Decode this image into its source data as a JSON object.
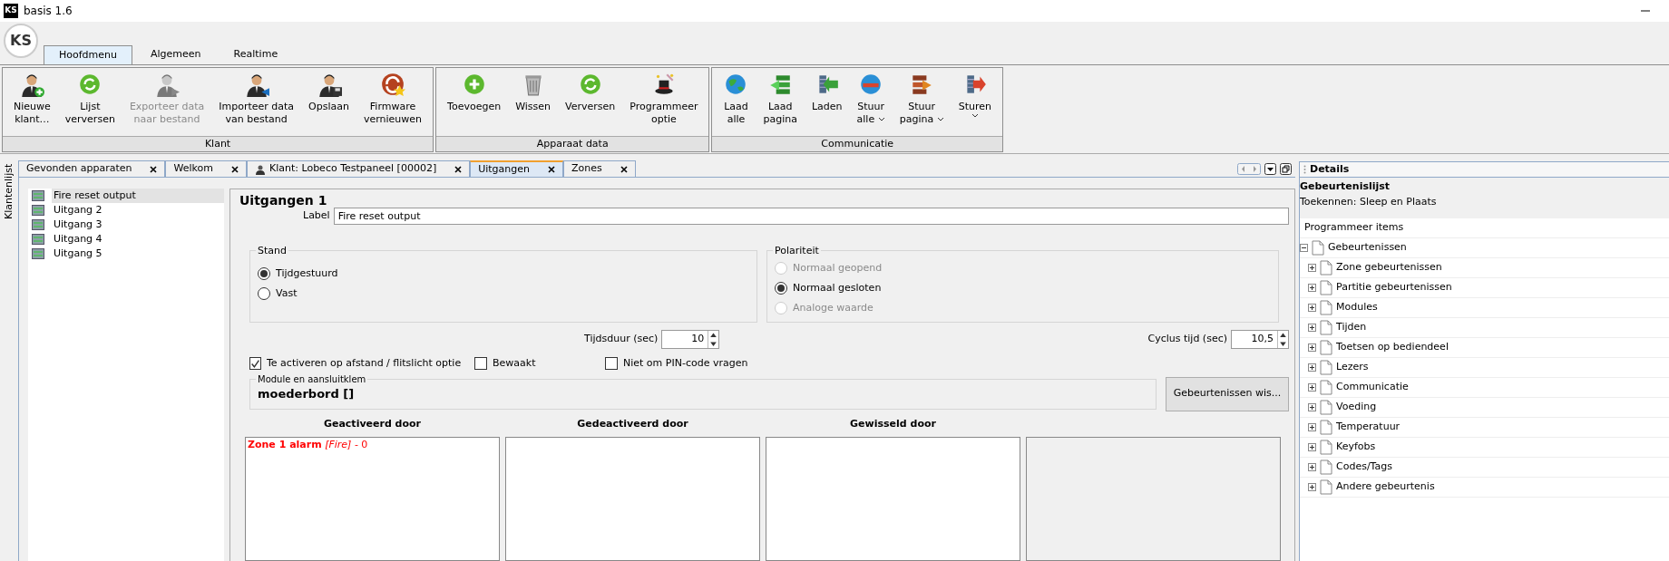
{
  "window": {
    "title": "basis 1.6",
    "logo": "KS"
  },
  "ribbon_logo": "KS",
  "ribbon_tabs": [
    {
      "label": "Hoofdmenu",
      "selected": true
    },
    {
      "label": "Algemeen",
      "selected": false
    },
    {
      "label": "Realtime",
      "selected": false
    }
  ],
  "ribbon_groups": [
    {
      "title": "Klant",
      "buttons": [
        {
          "kind": "person-add",
          "lines": [
            "Nieuwe",
            "klant…"
          ],
          "disabled": false,
          "has_menu": false
        },
        {
          "kind": "refresh",
          "lines": [
            "Lijst",
            "verversen"
          ],
          "disabled": false,
          "has_menu": false
        },
        {
          "kind": "person-export",
          "lines": [
            "Exporteer data",
            "naar bestand"
          ],
          "disabled": true,
          "has_menu": false
        },
        {
          "kind": "person-import",
          "lines": [
            "Importeer data",
            "van bestand"
          ],
          "disabled": false,
          "has_menu": false
        },
        {
          "kind": "person-save",
          "lines": [
            "Opslaan"
          ],
          "disabled": false,
          "has_menu": false
        },
        {
          "kind": "firmware",
          "lines": [
            "Firmware",
            "vernieuwen"
          ],
          "disabled": false,
          "has_menu": false
        }
      ]
    },
    {
      "title": "Apparaat data",
      "buttons": [
        {
          "kind": "add",
          "lines": [
            "Toevoegen"
          ],
          "disabled": false,
          "has_menu": false
        },
        {
          "kind": "trash",
          "lines": [
            "Wissen"
          ],
          "disabled": false,
          "has_menu": false
        },
        {
          "kind": "refresh",
          "lines": [
            "Verversen"
          ],
          "disabled": false,
          "has_menu": false
        },
        {
          "kind": "wand",
          "lines": [
            "Programmeer",
            "optie"
          ],
          "disabled": false,
          "has_menu": false
        }
      ]
    },
    {
      "title": "Communicatie",
      "buttons": [
        {
          "kind": "globe-green",
          "lines": [
            "Laad",
            "alle"
          ],
          "disabled": false,
          "has_menu": false
        },
        {
          "kind": "stack-green",
          "lines": [
            "Laad",
            "pagina"
          ],
          "disabled": false,
          "has_menu": false
        },
        {
          "kind": "arrow-green",
          "lines": [
            "Laden"
          ],
          "disabled": false,
          "has_menu": false
        },
        {
          "kind": "globe-red",
          "lines": [
            "Stuur",
            "alle"
          ],
          "disabled": false,
          "has_menu": true
        },
        {
          "kind": "stack-red",
          "lines": [
            "Stuur",
            "pagina"
          ],
          "disabled": false,
          "has_menu": true
        },
        {
          "kind": "arrow-red",
          "lines": [
            "Sturen"
          ],
          "disabled": false,
          "has_menu": true
        }
      ]
    }
  ],
  "side_strip": {
    "label": "Klantenlijst"
  },
  "doc_tabs": [
    {
      "label": "Gevonden apparaten",
      "selected": false,
      "has_icon": false
    },
    {
      "label": "Welkom",
      "selected": false,
      "has_icon": false
    },
    {
      "label": "Klant: Lobeco Testpaneel [00002]",
      "selected": false,
      "has_icon": true
    },
    {
      "label": "Uitgangen",
      "selected": true,
      "has_icon": false
    },
    {
      "label": "Zones",
      "selected": false,
      "has_icon": false
    }
  ],
  "outputs_list": [
    {
      "label": "Fire reset output",
      "selected": true
    },
    {
      "label": "Uitgang 2",
      "selected": false
    },
    {
      "label": "Uitgang 3",
      "selected": false
    },
    {
      "label": "Uitgang 4",
      "selected": false
    },
    {
      "label": "Uitgang 5",
      "selected": false
    }
  ],
  "form": {
    "title": "Uitgangen 1",
    "label_caption": "Label",
    "label_value": "Fire reset output",
    "stand": {
      "title": "Stand",
      "options": [
        {
          "label": "Tijdgestuurd",
          "selected": true,
          "disabled": false
        },
        {
          "label": "Vast",
          "selected": false,
          "disabled": false
        }
      ]
    },
    "polariteit": {
      "title": "Polariteit",
      "options": [
        {
          "label": "Normaal geopend",
          "selected": false,
          "disabled": true
        },
        {
          "label": "Normaal gesloten",
          "selected": true,
          "disabled": false
        },
        {
          "label": "Analoge waarde",
          "selected": false,
          "disabled": true
        }
      ]
    },
    "tijdsduur": {
      "label": "Tijdsduur (sec)",
      "value": "10"
    },
    "cyclus": {
      "label": "Cyclus tijd (sec)",
      "value": "10,5"
    },
    "checkboxes": [
      {
        "label": "Te activeren op afstand / flitslicht optie",
        "checked": true
      },
      {
        "label": "Bewaakt",
        "checked": false
      },
      {
        "label": "Niet om PIN-code vragen",
        "checked": false
      }
    ],
    "module": {
      "title": "Module en aansluitklem",
      "value": "moederbord []"
    },
    "clear_button": "Gebeurtenissen wis...",
    "columns": [
      {
        "title": "Geactiveerd door",
        "items": [
          "**Zone 1 alarm** *[Fire]* - 0"
        ]
      },
      {
        "title": "Gedeactiveerd door"
      },
      {
        "title": "Gewisseld door"
      }
    ]
  },
  "details": {
    "title": "Details",
    "heading": "Gebeurtenislijst",
    "subheading": "Toekennen: Sleep en Plaats",
    "list_caption": "Programmeer items",
    "tree": [
      {
        "label": "Gebeurtenissen",
        "expanded": true,
        "children": [
          {
            "label": "Zone gebeurtenissen",
            "expanded": false
          },
          {
            "label": "Partitie gebeurtenissen",
            "expanded": false
          },
          {
            "label": "Modules",
            "expanded": false
          },
          {
            "label": "Tijden",
            "expanded": false
          },
          {
            "label": "Toetsen op bediendeel",
            "expanded": false
          },
          {
            "label": "Lezers",
            "expanded": false
          },
          {
            "label": "Communicatie",
            "expanded": false
          },
          {
            "label": "Voeding",
            "expanded": false
          },
          {
            "label": "Temperatuur",
            "expanded": false
          },
          {
            "label": "Keyfobs",
            "expanded": false
          },
          {
            "label": "Codes/Tags",
            "expanded": false
          },
          {
            "label": "Andere gebeurtenis",
            "expanded": false
          }
        ]
      }
    ]
  }
}
